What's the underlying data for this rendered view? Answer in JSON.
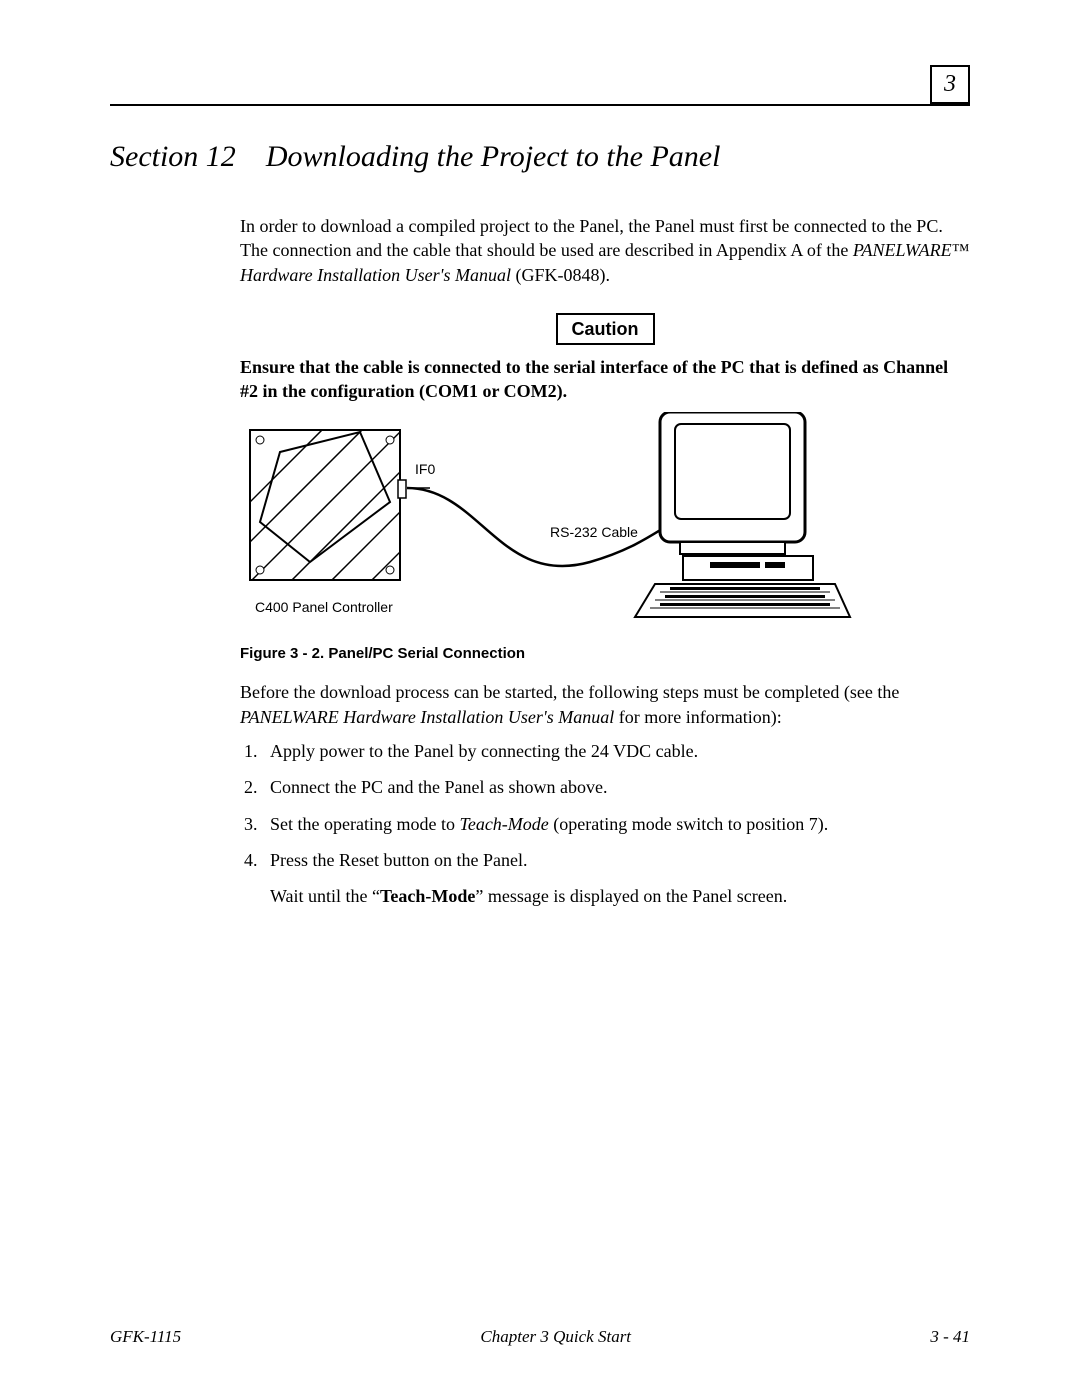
{
  "header": {
    "chapter_number": "3"
  },
  "section": {
    "label": "Section 12",
    "title": "Downloading the Project to the Panel"
  },
  "intro": {
    "line1": "In order to download a compiled project to the Panel, the Panel must first be connected to the PC. The connection and the cable that should be used are described in Appendix A of the ",
    "doc_ref_italic": "PANELWARE™ Hardware Installation User's Manual",
    "doc_ref_suffix": " (GFK-0848)."
  },
  "caution": {
    "label": "Caution",
    "text": "Ensure that the cable is connected to the serial interface of the PC that is defined as Channel #2 in the configuration (COM1 or COM2)."
  },
  "figure": {
    "label_if0": "IF0",
    "label_cable": "RS-232 Cable",
    "label_controller": "C400 Panel Controller",
    "caption": "Figure 3 - 2.  Panel/PC Serial Connection"
  },
  "before_steps": {
    "text_prefix": "Before the download process can be started, the following steps must be completed (see the ",
    "doc_ref_italic": "PANELWARE Hardware Installation User's Manual",
    "text_suffix": " for more information):"
  },
  "steps": {
    "s1": "Apply power to the Panel by connecting the 24 VDC cable.",
    "s2": "Connect the PC and the Panel as shown above.",
    "s3_prefix": "Set the operating mode to ",
    "s3_italic": "Teach-Mode",
    "s3_suffix": " (operating mode switch to position 7).",
    "s4": "Press the Reset button on the Panel.",
    "s4_wait_prefix": "Wait until the “",
    "s4_wait_bold": "Teach-Mode",
    "s4_wait_suffix": "” message is displayed on the Panel screen."
  },
  "footer": {
    "left": "GFK-1115",
    "center": "Chapter 3   Quick Start",
    "right": "3 - 41"
  }
}
